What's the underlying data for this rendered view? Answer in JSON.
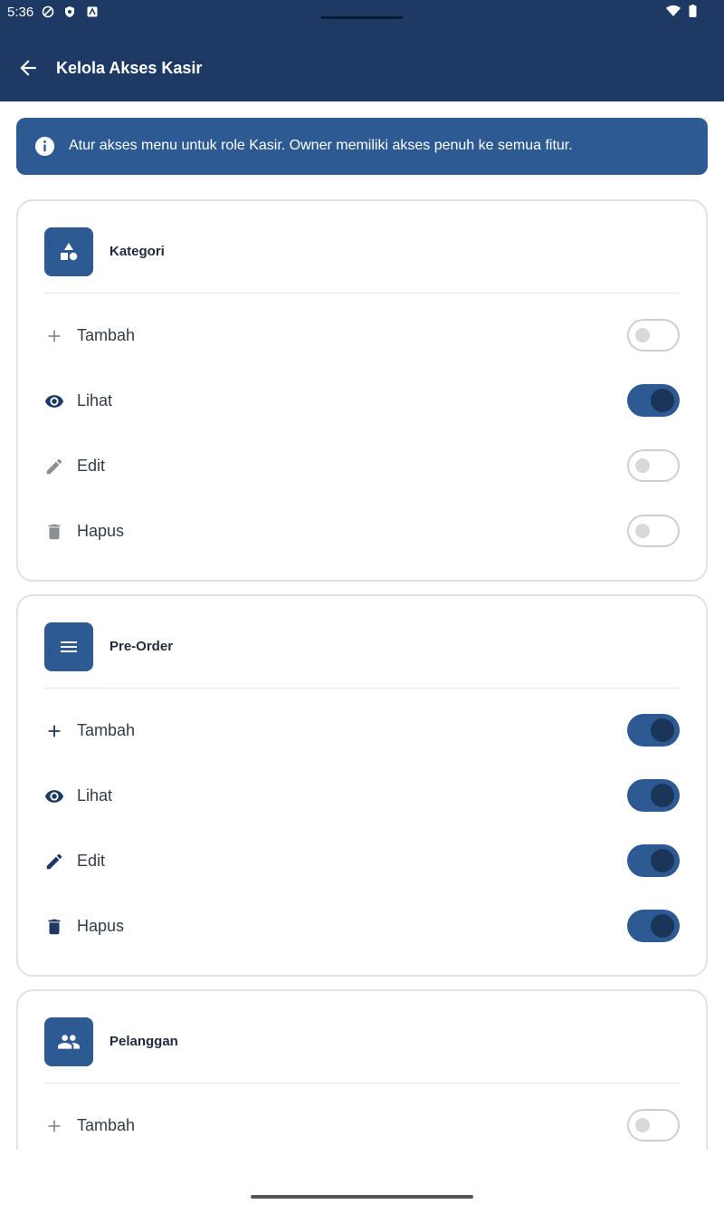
{
  "status_bar": {
    "time": "5:36"
  },
  "appbar": {
    "title": "Kelola Akses Kasir"
  },
  "info": {
    "text": "Atur akses menu untuk role Kasir. Owner memiliki akses penuh ke semua fitur."
  },
  "colors": {
    "primary": "#2d5a92",
    "header": "#1e3a64",
    "knob_on": "#1a3558"
  },
  "sections": [
    {
      "title": "Kategori",
      "icon": "category-shapes-icon",
      "permissions": [
        {
          "label": "Tambah",
          "icon": "plus-icon",
          "enabled": false
        },
        {
          "label": "Lihat",
          "icon": "eye-icon",
          "enabled": true
        },
        {
          "label": "Edit",
          "icon": "pencil-icon",
          "enabled": false
        },
        {
          "label": "Hapus",
          "icon": "trash-icon",
          "enabled": false
        }
      ]
    },
    {
      "title": "Pre-Order",
      "icon": "menu-lines-icon",
      "permissions": [
        {
          "label": "Tambah",
          "icon": "plus-icon",
          "enabled": true
        },
        {
          "label": "Lihat",
          "icon": "eye-icon",
          "enabled": true
        },
        {
          "label": "Edit",
          "icon": "pencil-icon",
          "enabled": true
        },
        {
          "label": "Hapus",
          "icon": "trash-icon",
          "enabled": true
        }
      ]
    },
    {
      "title": "Pelanggan",
      "icon": "people-icon",
      "permissions": [
        {
          "label": "Tambah",
          "icon": "plus-icon",
          "enabled": false
        }
      ]
    }
  ]
}
